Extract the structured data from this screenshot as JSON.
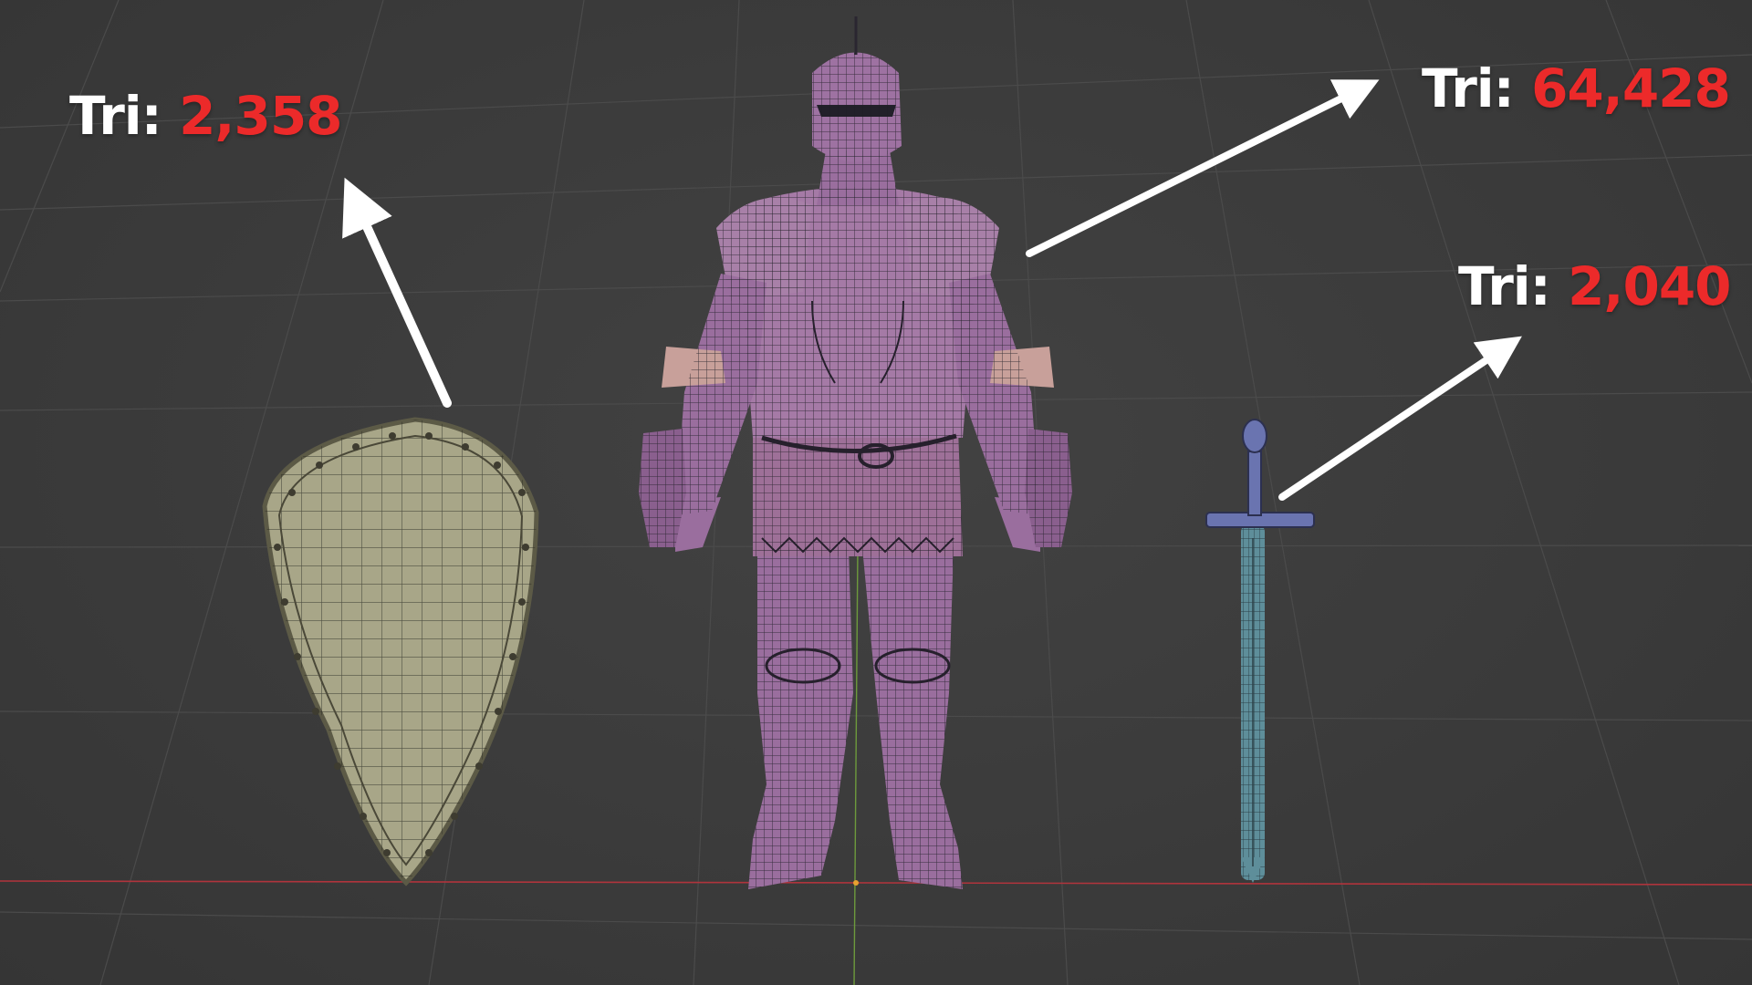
{
  "viewport": {
    "background": "#3a3a3a",
    "grid_color": "#4a4a4a",
    "x_axis_color": "#b0343c",
    "y_axis_color": "#6d9a3c"
  },
  "annotations": {
    "shield": {
      "prefix": "Tri:",
      "value": "2,358"
    },
    "knight": {
      "prefix": "Tri:",
      "value": "64,428"
    },
    "sword": {
      "prefix": "Tri:",
      "value": "2,040"
    }
  },
  "colors": {
    "label_prefix": "#ffffff",
    "label_value": "#ec2a2a",
    "arrow": "#ffffff",
    "shield_fill": "#a8a688",
    "knight_fill": "#9a6e9e",
    "sword_fill": "#5e8e9a",
    "wire": "#1e1e24"
  },
  "objects": [
    {
      "name": "shield-mesh",
      "icon": "shield"
    },
    {
      "name": "knight-armor-mesh",
      "icon": "armored-knight"
    },
    {
      "name": "sword-mesh",
      "icon": "sword"
    }
  ]
}
